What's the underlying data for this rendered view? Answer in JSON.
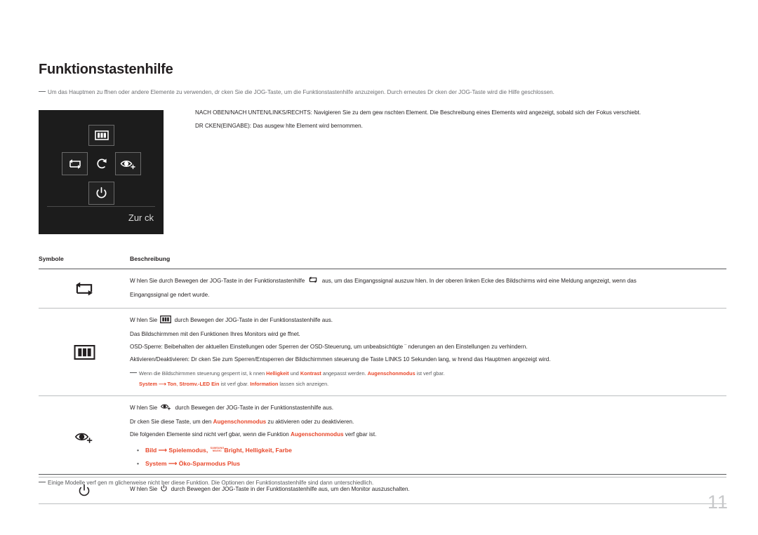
{
  "document": {
    "title": "Funktionstastenhilfe",
    "page_number": "11",
    "lead_note": "Um das Hauptmen  zu  ffnen oder andere Elemente zu verwenden, dr cken Sie die JOG-Taste, um die Funktionstastenhilfe anzuzeigen. Durch erneutes Dr cken der JOG-Taste wird die Hilfe geschlossen.",
    "footer_note": "Einige Modelle verf gen m glicherweise nicht  ber diese Funktion. Die Optionen der Funktionstastenhilfe sind dann unterschiedlich."
  },
  "jog_panel": {
    "back_label": "Zur ck",
    "keys": {
      "up": "osd-menu-icon",
      "left": "input-source-icon",
      "center": "return-icon",
      "right": "eye-saver-icon",
      "down": "power-icon"
    }
  },
  "instructions": {
    "line1": "NACH OBEN/NACH UNTEN/LINKS/RECHTS: Navigieren Sie zu dem gew  nschten Element. Die Beschreibung eines Elements wird angezeigt, sobald sich der Fokus verschiebt.",
    "line2": "DR CKEN(EINGABE): Das ausgew hlte Element wird  bernommen."
  },
  "table": {
    "headers": {
      "symbols": "Symbole",
      "description": "Beschreibung"
    },
    "rows": [
      {
        "icon": "input-source-icon",
        "lines": [
          {
            "parts": [
              {
                "t": "text",
                "v": "W hlen Sie durch Bewegen der JOG-Taste in der Funktionstastenhilfe "
              },
              {
                "t": "icon",
                "v": "input-source-icon"
              },
              {
                "t": "text",
                "v": " aus, um das Eingangssignal auszuw  hlen. In der oberen linken Ecke des Bildschirms wird eine Meldung angezeigt, wenn das"
              }
            ]
          },
          {
            "parts": [
              {
                "t": "text",
                "v": "Eingangssignal ge ndert wurde."
              }
            ]
          }
        ]
      },
      {
        "icon": "osd-menu-icon",
        "lines": [
          {
            "parts": [
              {
                "t": "text",
                "v": "W hlen Sie "
              },
              {
                "t": "icon",
                "v": "osd-menu-icon"
              },
              {
                "t": "text",
                "v": " durch Bewegen der JOG-Taste in der Funktionstastenhilfe aus."
              }
            ]
          },
          {
            "parts": [
              {
                "t": "text",
                "v": "Das Bildschirmmen  mit den Funktionen Ihres Monitors wird ge ffnet."
              }
            ]
          },
          {
            "parts": [
              {
                "t": "text",
                "v": "OSD-Sperre: Beibehalten der aktuellen Einstellungen oder Sperren der OSD-Steuerung, um unbeabsichtigte ¨ nderungen an den Einstellungen zu verhindern."
              }
            ]
          },
          {
            "parts": [
              {
                "t": "text",
                "v": "Aktivieren/Deaktivieren: Dr cken Sie zum Sperren/Entsperren der Bildschirmmen  steuerung die Taste LINKS 10 Sekunden lang, w hrend das Hauptmen  angezeigt wird."
              }
            ]
          }
        ],
        "note": [
          {
            "parts": [
              {
                "t": "dash",
                "v": ""
              },
              {
                "t": "text",
                "v": "Wenn die Bildschirmmen  steuerung gesperrt ist, k nnen "
              },
              {
                "t": "hi",
                "v": "Helligkeit"
              },
              {
                "t": "text",
                "v": " und "
              },
              {
                "t": "hi",
                "v": "Kontrast"
              },
              {
                "t": "text",
                "v": " angepasst werden. "
              },
              {
                "t": "hi",
                "v": "Augenschonmodus"
              },
              {
                "t": "text",
                "v": " ist verf gbar."
              }
            ]
          },
          {
            "parts": [
              {
                "t": "hi",
                "v": "System"
              },
              {
                "t": "arrowhi",
                "v": ""
              },
              {
                "t": "hi",
                "v": "Ton"
              },
              {
                "t": "hiplain",
                "v": ", "
              },
              {
                "t": "hi",
                "v": "Stromv.-LED Ein"
              },
              {
                "t": "text",
                "v": " ist verf gbar. "
              },
              {
                "t": "hi",
                "v": "Information"
              },
              {
                "t": "text",
                "v": " lassen sich anzeigen."
              }
            ]
          }
        ]
      },
      {
        "icon": "eye-saver-icon",
        "lines": [
          {
            "parts": [
              {
                "t": "text",
                "v": "W hlen Sie "
              },
              {
                "t": "icon",
                "v": "eye-saver-icon"
              },
              {
                "t": "text",
                "v": " durch Bewegen der JOG-Taste in der Funktionstastenhilfe aus."
              }
            ]
          },
          {
            "parts": [
              {
                "t": "text",
                "v": "Dr cken Sie diese Taste, um den "
              },
              {
                "t": "hi",
                "v": "Augenschonmodus"
              },
              {
                "t": "text",
                "v": " zu aktivieren oder zu deaktivieren."
              }
            ]
          },
          {
            "parts": [
              {
                "t": "text",
                "v": "Die folgenden Elemente sind nicht verf  gbar, wenn die Funktion "
              },
              {
                "t": "hi",
                "v": "Augenschonmodus"
              },
              {
                "t": "text",
                "v": " verf  gbar ist."
              }
            ]
          }
        ],
        "bullets": [
          {
            "parts": [
              {
                "t": "hi",
                "v": "Bild"
              },
              {
                "t": "arrowhi",
                "v": ""
              },
              {
                "t": "hi",
                "v": "Spielemodus"
              },
              {
                "t": "hiplain",
                "v": ", "
              },
              {
                "t": "smagic",
                "v": "SAMSUNG|MAGIC"
              },
              {
                "t": "hi",
                "v": "Bright"
              },
              {
                "t": "hiplain",
                "v": ", "
              },
              {
                "t": "hi",
                "v": "Helligkeit"
              },
              {
                "t": "hiplain",
                "v": ", "
              },
              {
                "t": "hi",
                "v": "Farbe"
              }
            ]
          },
          {
            "parts": [
              {
                "t": "hi",
                "v": "System"
              },
              {
                "t": "arrowhi",
                "v": ""
              },
              {
                "t": "hi",
                "v": "Öko-Sparmodus Plus"
              }
            ]
          }
        ]
      },
      {
        "icon": "power-icon",
        "lines": [
          {
            "parts": [
              {
                "t": "text",
                "v": "W hlen Sie "
              },
              {
                "t": "icon",
                "v": "power-icon"
              },
              {
                "t": "text",
                "v": " durch Bewegen der JOG-Taste in der Funktionstastenhilfe aus, um den Monitor auszuschalten."
              }
            ]
          }
        ]
      }
    ]
  },
  "colors": {
    "accent": "#e8472a",
    "text": "#231f20",
    "muted": "#58595b",
    "panel_bg": "#1c1c1c",
    "page_number": "#c7c8ca"
  }
}
